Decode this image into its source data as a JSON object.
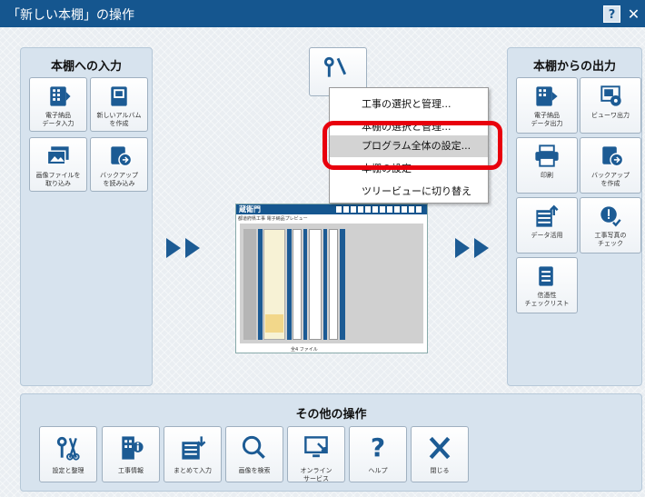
{
  "window": {
    "title": "「新しい本棚」の操作",
    "help": "?",
    "close": "✕"
  },
  "input_panel": {
    "title": "本棚への入力",
    "buttons": [
      {
        "name": "ebook-data-input",
        "label": "電子納品\nデータ入力"
      },
      {
        "name": "new-album",
        "label": "新しいアルバム\nを作成"
      },
      {
        "name": "import-images",
        "label": "画像ファイルを\n取り込み"
      },
      {
        "name": "load-backup",
        "label": "バックアップ\nを読み込み"
      }
    ]
  },
  "output_panel": {
    "title": "本棚からの出力",
    "buttons": [
      {
        "name": "ebook-data-output",
        "label": "電子納品\nデータ出力"
      },
      {
        "name": "viewer-output",
        "label": "ビューワ出力"
      },
      {
        "name": "print",
        "label": "印刷"
      },
      {
        "name": "create-backup",
        "label": "バックアップ\nを作成"
      },
      {
        "name": "data-usage",
        "label": "データ活用"
      },
      {
        "name": "photo-check",
        "label": "工事写真の\nチェック"
      },
      {
        "name": "credibility-checklist",
        "label": "信憑性\nチェックリスト"
      }
    ]
  },
  "context_menu": {
    "items": [
      "工事の選択と管理...",
      "本棚の選択と管理...",
      "プログラム全体の設定...",
      "本棚の設定",
      "ツリービューに切り替え"
    ],
    "highlighted_index": 2
  },
  "preview": {
    "app_logo": "蔵衛門",
    "header_text": "都道府県工事 電子納品プレビュー",
    "status_text": "全4 ファイル"
  },
  "other_ops": {
    "title": "その他の操作",
    "buttons": [
      {
        "name": "settings-maintenance",
        "label": "設定と整理"
      },
      {
        "name": "project-info",
        "label": "工事情報"
      },
      {
        "name": "batch-input",
        "label": "まとめて入力"
      },
      {
        "name": "image-search",
        "label": "画像を検索"
      },
      {
        "name": "online-service",
        "label": "オンライン\nサービス"
      },
      {
        "name": "help",
        "label": "ヘルプ"
      },
      {
        "name": "close",
        "label": "閉じる"
      }
    ]
  },
  "colors": {
    "titlebar": "#15568f",
    "accent": "#1c5b94",
    "highlight_box": "#e8000d",
    "panel": "#d7e3ee"
  }
}
